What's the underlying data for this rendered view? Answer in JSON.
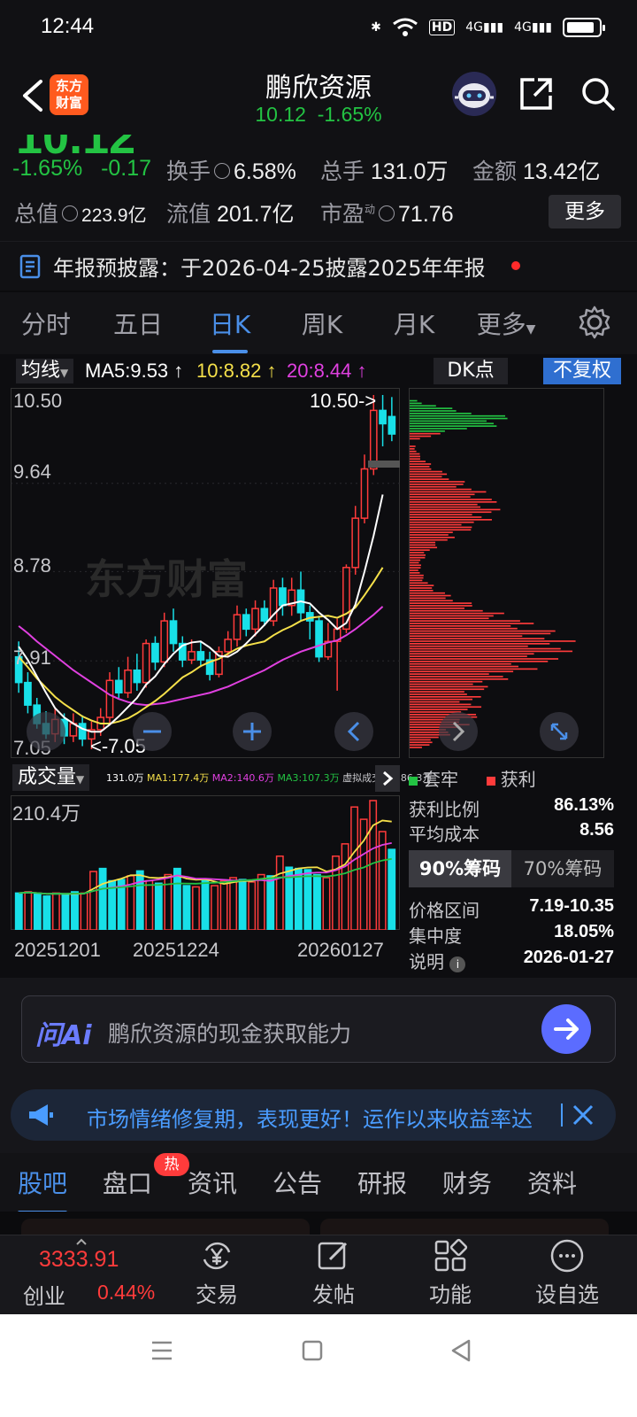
{
  "status": {
    "time": "12:44",
    "hd": "HD",
    "sig1": "4G",
    "sig2": "4G"
  },
  "header": {
    "title": "鹏欣资源",
    "price": "10.12",
    "change_pct": "-1.65%",
    "logo_line1": "东方",
    "logo_line2": "财富"
  },
  "quote": {
    "big_price": "10.12",
    "change_pct": "-1.65%",
    "change": "-0.17",
    "turnover_label": "换手",
    "turnover": "6.58%",
    "volume_label": "总手",
    "volume": "131.0万",
    "amount_label": "金额",
    "amount": "13.42亿",
    "mktcap_label": "总值",
    "mktcap": "223.9亿",
    "float_label": "流值",
    "float": "201.7亿",
    "pe_label": "市盈",
    "pe_sup": "动",
    "pe": "71.76",
    "more": "更多"
  },
  "notice": {
    "text": "年报预披露：于2026-04-25披露2025年年报"
  },
  "period_tabs": [
    "分时",
    "五日",
    "日K",
    "周K",
    "月K",
    "更多"
  ],
  "chart": {
    "ma_button": "均线",
    "ma5": "MA5:9.53",
    "ma10": "10:8.82",
    "ma20": "20:8.44",
    "dk": "DK点",
    "fq": "不复权",
    "y_ticks": [
      "10.50",
      "9.64",
      "8.78",
      "7.91"
    ],
    "high_marker": "10.50->",
    "low_marker": "<-7.05",
    "low_left": "7.05",
    "vol_label": "成交量",
    "vol_stats": {
      "v": "131.0万",
      "ma1": "MA1:177.4万",
      "ma2": "MA2:140.6万",
      "ma3": "MA3:107.3万",
      "virtual": "虚拟成交量:186.3万"
    },
    "vol_max": "210.4万",
    "dates": [
      "20251201",
      "20251224",
      "20260127"
    ],
    "watermark": "东方财富",
    "colors": {
      "up": "#ff3b3b",
      "down": "#18e0e8",
      "ma5": "#ffffff",
      "ma10": "#f5e04a",
      "ma20": "#e040e0"
    }
  },
  "chart_data": {
    "type": "candlestick",
    "ylim": [
      7.05,
      10.5
    ],
    "candles": [
      {
        "o": 7.95,
        "c": 7.7,
        "h": 8.1,
        "l": 7.6
      },
      {
        "o": 7.7,
        "c": 7.48,
        "h": 7.8,
        "l": 7.4
      },
      {
        "o": 7.48,
        "c": 7.3,
        "h": 7.55,
        "l": 7.25
      },
      {
        "o": 7.3,
        "c": 7.2,
        "h": 7.42,
        "l": 7.15
      },
      {
        "o": 7.2,
        "c": 7.34,
        "h": 7.45,
        "l": 7.12
      },
      {
        "o": 7.34,
        "c": 7.18,
        "h": 7.4,
        "l": 7.1
      },
      {
        "o": 7.18,
        "c": 7.3,
        "h": 7.4,
        "l": 7.12
      },
      {
        "o": 7.3,
        "c": 7.15,
        "h": 7.38,
        "l": 7.08
      },
      {
        "o": 7.15,
        "c": 7.24,
        "h": 7.32,
        "l": 7.05
      },
      {
        "o": 7.24,
        "c": 7.36,
        "h": 7.45,
        "l": 7.18
      },
      {
        "o": 7.36,
        "c": 7.72,
        "h": 7.8,
        "l": 7.3
      },
      {
        "o": 7.72,
        "c": 7.6,
        "h": 7.85,
        "l": 7.55
      },
      {
        "o": 7.6,
        "c": 7.82,
        "h": 7.95,
        "l": 7.55
      },
      {
        "o": 7.82,
        "c": 7.7,
        "h": 7.98,
        "l": 7.62
      },
      {
        "o": 7.7,
        "c": 8.08,
        "h": 8.12,
        "l": 7.65
      },
      {
        "o": 8.08,
        "c": 7.9,
        "h": 8.15,
        "l": 7.82
      },
      {
        "o": 7.9,
        "c": 8.3,
        "h": 8.38,
        "l": 7.85
      },
      {
        "o": 8.3,
        "c": 8.08,
        "h": 8.42,
        "l": 8.0
      },
      {
        "o": 8.08,
        "c": 7.92,
        "h": 8.15,
        "l": 7.85
      },
      {
        "o": 7.92,
        "c": 8.0,
        "h": 8.12,
        "l": 7.88
      },
      {
        "o": 8.0,
        "c": 7.92,
        "h": 8.1,
        "l": 7.85
      },
      {
        "o": 7.92,
        "c": 7.78,
        "h": 8.0,
        "l": 7.72
      },
      {
        "o": 7.78,
        "c": 8.0,
        "h": 8.05,
        "l": 7.75
      },
      {
        "o": 8.0,
        "c": 8.12,
        "h": 8.2,
        "l": 7.95
      },
      {
        "o": 8.12,
        "c": 8.36,
        "h": 8.45,
        "l": 8.05
      },
      {
        "o": 8.36,
        "c": 8.22,
        "h": 8.42,
        "l": 8.15
      },
      {
        "o": 8.22,
        "c": 8.42,
        "h": 8.5,
        "l": 8.15
      },
      {
        "o": 8.42,
        "c": 8.3,
        "h": 8.5,
        "l": 8.25
      },
      {
        "o": 8.3,
        "c": 8.62,
        "h": 8.7,
        "l": 8.25
      },
      {
        "o": 8.62,
        "c": 8.45,
        "h": 8.72,
        "l": 8.35
      },
      {
        "o": 8.45,
        "c": 8.6,
        "h": 8.72,
        "l": 8.35
      },
      {
        "o": 8.6,
        "c": 8.38,
        "h": 8.78,
        "l": 8.3
      },
      {
        "o": 8.38,
        "c": 8.3,
        "h": 8.45,
        "l": 8.12
      },
      {
        "o": 8.3,
        "c": 7.95,
        "h": 8.35,
        "l": 7.9
      },
      {
        "o": 7.95,
        "c": 8.1,
        "h": 8.28,
        "l": 7.92
      },
      {
        "o": 8.1,
        "c": 8.22,
        "h": 8.32,
        "l": 7.62
      },
      {
        "o": 8.22,
        "c": 8.82,
        "h": 8.85,
        "l": 8.18
      },
      {
        "o": 8.82,
        "c": 9.3,
        "h": 9.42,
        "l": 8.75
      },
      {
        "o": 9.3,
        "c": 9.78,
        "h": 9.92,
        "l": 9.25
      },
      {
        "o": 9.78,
        "c": 10.35,
        "h": 10.5,
        "l": 9.72
      },
      {
        "o": 10.35,
        "c": 10.22,
        "h": 10.5,
        "l": 10.0
      },
      {
        "o": 10.29,
        "c": 10.12,
        "h": 10.48,
        "l": 10.05
      }
    ],
    "ma5": [
      8.05,
      7.92,
      7.76,
      7.6,
      7.45,
      7.36,
      7.3,
      7.25,
      7.22,
      7.22,
      7.29,
      7.37,
      7.46,
      7.55,
      7.68,
      7.76,
      7.88,
      7.98,
      8.06,
      8.09,
      8.1,
      8.04,
      7.96,
      7.95,
      8.0,
      8.08,
      8.17,
      8.26,
      8.36,
      8.45,
      8.47,
      8.49,
      8.47,
      8.38,
      8.31,
      8.22,
      8.28,
      8.46,
      8.78,
      9.13,
      9.53
    ],
    "ma10": [
      7.95,
      7.85,
      7.74,
      7.65,
      7.56,
      7.49,
      7.43,
      7.37,
      7.33,
      7.3,
      7.3,
      7.32,
      7.35,
      7.4,
      7.46,
      7.52,
      7.59,
      7.67,
      7.75,
      7.8,
      7.86,
      7.9,
      7.93,
      7.98,
      8.03,
      8.06,
      8.08,
      8.1,
      8.16,
      8.21,
      8.25,
      8.3,
      8.33,
      8.34,
      8.35,
      8.33,
      8.37,
      8.43,
      8.55,
      8.68,
      8.82
    ],
    "ma20": [
      8.25,
      8.18,
      8.1,
      8.03,
      7.96,
      7.89,
      7.82,
      7.76,
      7.7,
      7.64,
      7.58,
      7.54,
      7.51,
      7.49,
      7.48,
      7.49,
      7.5,
      7.52,
      7.54,
      7.56,
      7.58,
      7.6,
      7.63,
      7.66,
      7.7,
      7.74,
      7.78,
      7.82,
      7.87,
      7.92,
      7.96,
      8.0,
      8.03,
      8.06,
      8.09,
      8.11,
      8.16,
      8.22,
      8.29,
      8.36,
      8.44
    ],
    "volume": [
      {
        "v": 60,
        "up": false
      },
      {
        "v": 62,
        "up": true
      },
      {
        "v": 58,
        "up": false
      },
      {
        "v": 55,
        "up": false
      },
      {
        "v": 60,
        "up": true
      },
      {
        "v": 58,
        "up": false
      },
      {
        "v": 62,
        "up": false
      },
      {
        "v": 60,
        "up": true
      },
      {
        "v": 95,
        "up": true
      },
      {
        "v": 100,
        "up": false
      },
      {
        "v": 80,
        "up": false
      },
      {
        "v": 82,
        "up": false
      },
      {
        "v": 88,
        "up": true
      },
      {
        "v": 96,
        "up": false
      },
      {
        "v": 80,
        "up": true
      },
      {
        "v": 76,
        "up": false
      },
      {
        "v": 90,
        "up": true
      },
      {
        "v": 100,
        "up": false
      },
      {
        "v": 72,
        "up": false
      },
      {
        "v": 70,
        "up": true
      },
      {
        "v": 80,
        "up": false
      },
      {
        "v": 72,
        "up": true
      },
      {
        "v": 80,
        "up": true
      },
      {
        "v": 85,
        "up": true
      },
      {
        "v": 82,
        "up": false
      },
      {
        "v": 78,
        "up": true
      },
      {
        "v": 90,
        "up": true
      },
      {
        "v": 88,
        "up": false
      },
      {
        "v": 120,
        "up": true
      },
      {
        "v": 102,
        "up": false
      },
      {
        "v": 100,
        "up": false
      },
      {
        "v": 98,
        "up": false
      },
      {
        "v": 90,
        "up": false
      },
      {
        "v": 85,
        "up": true
      },
      {
        "v": 120,
        "up": true
      },
      {
        "v": 140,
        "up": true
      },
      {
        "v": 200,
        "up": true
      },
      {
        "v": 180,
        "up": true
      },
      {
        "v": 210.4,
        "up": true
      },
      {
        "v": 160,
        "up": true
      },
      {
        "v": 131,
        "up": false
      }
    ],
    "vol_ylim": [
      0,
      210.4
    ],
    "chips": {
      "profit_share": 0.8613,
      "avg_cost": 8.56
    }
  },
  "chips": {
    "legend_trap": "套牢",
    "legend_profit": "获利",
    "profit_ratio_label": "获利比例",
    "profit_ratio": "86.13%",
    "avg_cost_label": "平均成本",
    "avg_cost": "8.56",
    "tab90": "90%筹码",
    "tab70": "70%筹码",
    "range_label": "价格区间",
    "range": "7.19-10.35",
    "concentration_label": "集中度",
    "concentration": "18.05%",
    "note_label": "说明",
    "note_date": "2026-01-27"
  },
  "ai": {
    "logo": "问Ai",
    "prompt": "鹏欣资源的现金获取能力"
  },
  "marquee": {
    "text": "市场情绪修复期，表现更好！运作以来收益率达"
  },
  "section_tabs": [
    "股吧",
    "盘口",
    "资讯",
    "公告",
    "研报",
    "财务",
    "资料"
  ],
  "hot_badge": "热",
  "bottom_bar": {
    "index_value": "3333.91",
    "index_name": "创业",
    "index_change": "0.44%",
    "tabs": [
      "交易",
      "发帖",
      "功能",
      "设自选"
    ]
  }
}
